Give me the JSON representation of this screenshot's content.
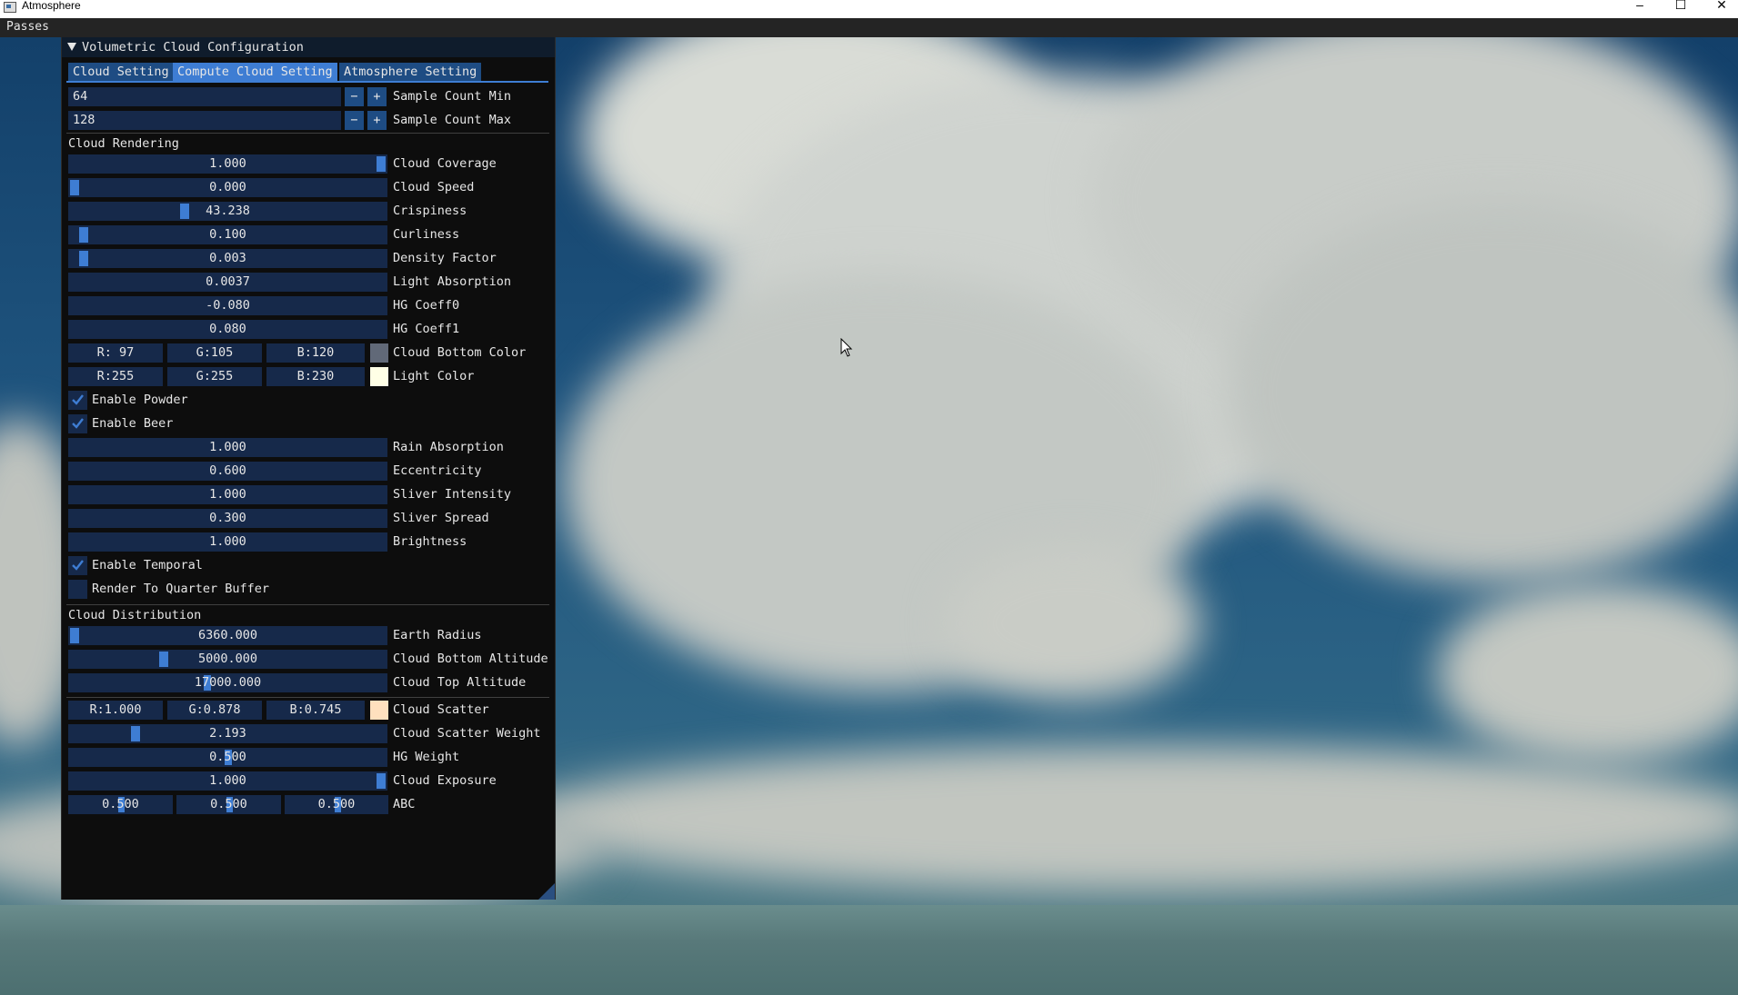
{
  "window": {
    "title": "Atmosphere",
    "controls": [
      "–",
      "☐",
      "✕"
    ]
  },
  "menubar": {
    "menu": "Passes"
  },
  "panel": {
    "title": "Volumetric Cloud Configuration",
    "tabs": [
      {
        "label": "Cloud Setting",
        "active": false
      },
      {
        "label": "Compute Cloud Setting",
        "active": true
      },
      {
        "label": "Atmosphere Setting",
        "active": false
      }
    ],
    "sample_min": {
      "value": "64",
      "label": "Sample Count Min",
      "minus": "−",
      "plus": "+"
    },
    "sample_max": {
      "value": "128",
      "label": "Sample Count Max",
      "minus": "−",
      "plus": "+"
    },
    "rendering": {
      "heading": "Cloud Rendering",
      "coverage": {
        "value": "1.000",
        "label": "Cloud Coverage",
        "fraction": 1.0
      },
      "speed": {
        "value": "0.000",
        "label": "Cloud Speed",
        "fraction": 0.0
      },
      "crispiness": {
        "value": "43.238",
        "label": "Crispiness",
        "fraction": 0.36
      },
      "curliness": {
        "value": "0.100",
        "label": "Curliness",
        "fraction": 0.03
      },
      "density": {
        "value": "0.003",
        "label": "Density Factor",
        "fraction": 0.03
      },
      "light_absorption": {
        "value": "0.0037",
        "label": "Light Absorption"
      },
      "hg0": {
        "value": "-0.080",
        "label": "HG Coeff0"
      },
      "hg1": {
        "value": "0.080",
        "label": "HG Coeff1"
      },
      "bottom_color": {
        "r": "R: 97",
        "g": "G:105",
        "b": "B:120",
        "label": "Cloud Bottom Color",
        "swatch": "#616978"
      },
      "light_color": {
        "r": "R:255",
        "g": "G:255",
        "b": "B:230",
        "label": "Light Color",
        "swatch": "#ffffe6"
      },
      "powder": {
        "label": "Enable Powder",
        "checked": true
      },
      "beer": {
        "label": "Enable Beer",
        "checked": true
      },
      "rain": {
        "value": "1.000",
        "label": "Rain Absorption"
      },
      "eccentricity": {
        "value": "0.600",
        "label": "Eccentricity"
      },
      "sliver_intensity": {
        "value": "1.000",
        "label": "Sliver Intensity"
      },
      "sliver_spread": {
        "value": "0.300",
        "label": "Sliver Spread"
      },
      "brightness": {
        "value": "1.000",
        "label": "Brightness"
      },
      "temporal": {
        "label": "Enable Temporal",
        "checked": true
      },
      "quarter": {
        "label": "Render To Quarter Buffer",
        "checked": false
      }
    },
    "distribution": {
      "heading": "Cloud Distribution",
      "earth_radius": {
        "value": "6360.000",
        "label": "Earth Radius",
        "fraction": 0.0
      },
      "bottom_alt": {
        "value": "5000.000",
        "label": "Cloud Bottom Altitude",
        "fraction": 0.29
      },
      "top_alt": {
        "value": "17000.000",
        "label": "Cloud Top Altitude"
      },
      "scatter": {
        "r": "R:1.000",
        "g": "G:0.878",
        "b": "B:0.745",
        "label": "Cloud Scatter",
        "swatch": "#ffe0be"
      },
      "scatter_weight": {
        "value": "2.193",
        "label": "Cloud Scatter Weight",
        "fraction": 0.2
      },
      "hg_weight": {
        "value": "0.500",
        "label": "HG Weight"
      },
      "exposure": {
        "value": "1.000",
        "label": "Cloud Exposure",
        "fraction": 1.0
      },
      "abc": {
        "a": "0.500",
        "b": "0.500",
        "c": "0.500",
        "label": "ABC"
      }
    }
  }
}
